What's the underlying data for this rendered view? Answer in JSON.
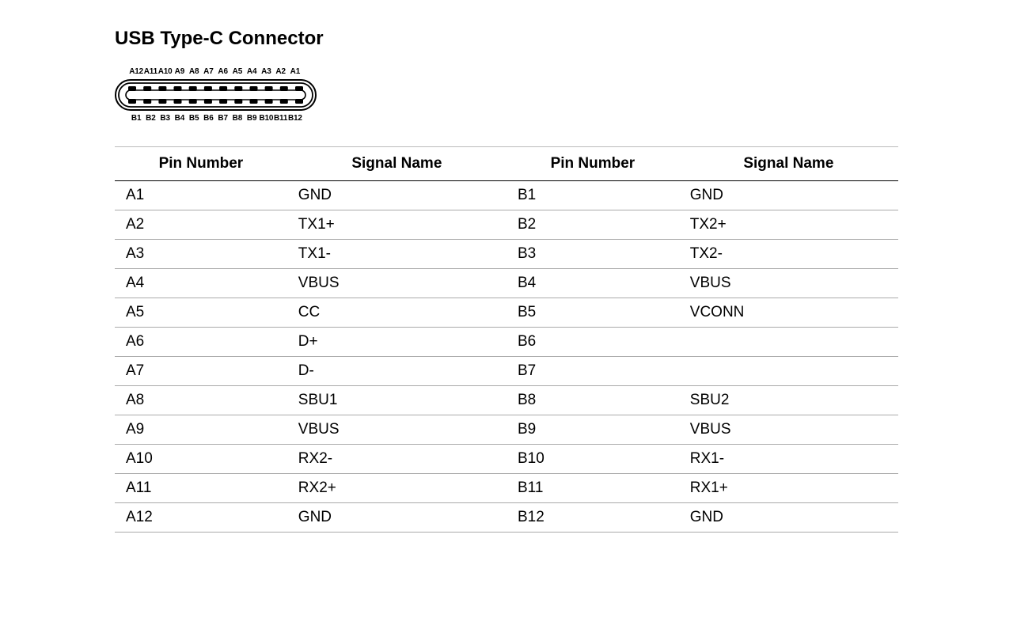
{
  "title": "USB Type-C Connector",
  "connector": {
    "topPins": [
      "A12",
      "A11",
      "A10",
      "A9",
      "A8",
      "A7",
      "A6",
      "A5",
      "A4",
      "A3",
      "A2",
      "A1"
    ],
    "bottomPins": [
      "B1",
      "B2",
      "B3",
      "B4",
      "B5",
      "B6",
      "B7",
      "B8",
      "B9",
      "B10",
      "B11",
      "B12"
    ]
  },
  "table": {
    "headers": [
      "Pin Number",
      "Signal Name",
      "Pin Number",
      "Signal Name"
    ],
    "rows": [
      {
        "aPin": "A1",
        "aSig": "GND",
        "bPin": "B1",
        "bSig": "GND"
      },
      {
        "aPin": "A2",
        "aSig": "TX1+",
        "bPin": "B2",
        "bSig": "TX2+"
      },
      {
        "aPin": "A3",
        "aSig": "TX1-",
        "bPin": "B3",
        "bSig": "TX2-"
      },
      {
        "aPin": "A4",
        "aSig": "VBUS",
        "bPin": "B4",
        "bSig": "VBUS"
      },
      {
        "aPin": "A5",
        "aSig": "CC",
        "bPin": "B5",
        "bSig": "VCONN"
      },
      {
        "aPin": "A6",
        "aSig": "D+",
        "bPin": "B6",
        "bSig": ""
      },
      {
        "aPin": "A7",
        "aSig": "D-",
        "bPin": "B7",
        "bSig": ""
      },
      {
        "aPin": "A8",
        "aSig": "SBU1",
        "bPin": "B8",
        "bSig": "SBU2"
      },
      {
        "aPin": "A9",
        "aSig": "VBUS",
        "bPin": "B9",
        "bSig": "VBUS"
      },
      {
        "aPin": "A10",
        "aSig": "RX2-",
        "bPin": "B10",
        "bSig": "RX1-"
      },
      {
        "aPin": "A11",
        "aSig": "RX2+",
        "bPin": "B11",
        "bSig": "RX1+"
      },
      {
        "aPin": "A12",
        "aSig": "GND",
        "bPin": "B12",
        "bSig": "GND"
      }
    ]
  }
}
